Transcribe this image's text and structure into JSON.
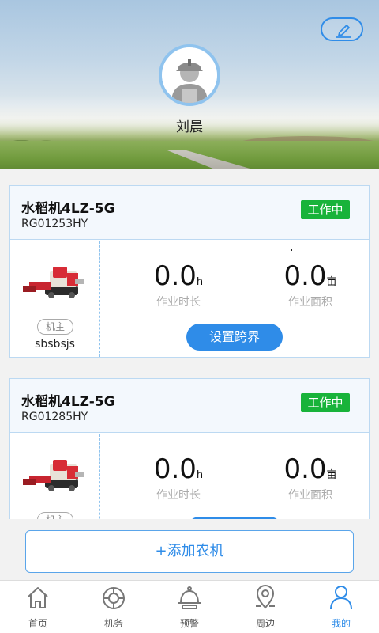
{
  "profile": {
    "username": "刘晨"
  },
  "cards": [
    {
      "machine_name": "水稻机4LZ-5G",
      "machine_code": "RG01253HY",
      "status": "工作中",
      "owner_tag": "机主",
      "owner_name": "sbsbsjs",
      "hours_value": "0.0",
      "hours_unit": "h",
      "hours_label": "作业时长",
      "area_value": "0.0",
      "area_unit": "亩",
      "area_label": "作业面积",
      "cross_button": "设置跨界"
    },
    {
      "machine_name": "水稻机4LZ-5G",
      "machine_code": "RG01285HY",
      "status": "工作中",
      "owner_tag": "机主",
      "hours_value": "0.0",
      "hours_unit": "h",
      "hours_label": "作业时长",
      "area_value": "0.0",
      "area_unit": "亩",
      "area_label": "作业面积"
    }
  ],
  "add_machine_label": "+添加农机",
  "tabs": [
    {
      "label": "首页",
      "icon": "home-icon",
      "active": false
    },
    {
      "label": "机务",
      "icon": "lifebuoy-icon",
      "active": false
    },
    {
      "label": "预警",
      "icon": "alarm-bell-icon",
      "active": false
    },
    {
      "label": "周边",
      "icon": "map-pin-icon",
      "active": false
    },
    {
      "label": "我的",
      "icon": "user-icon",
      "active": true
    }
  ],
  "colors": {
    "accent": "#2f8ce8",
    "status_green": "#18b33a",
    "card_border": "#bcd9f2"
  }
}
